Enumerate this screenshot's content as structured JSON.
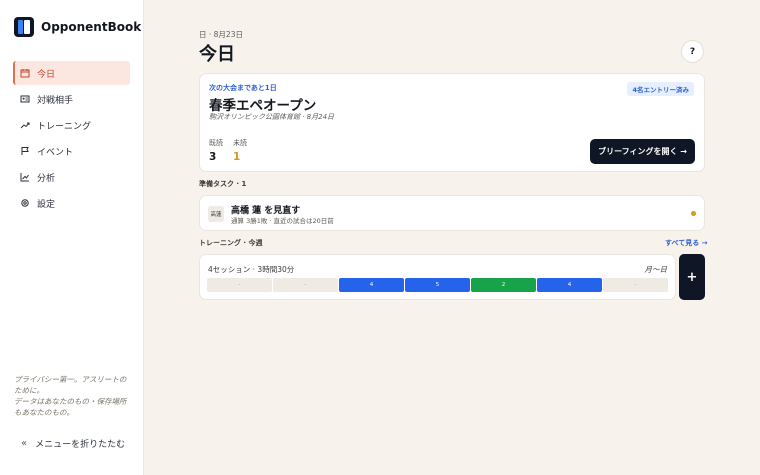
{
  "app": {
    "name": "OpponentBook"
  },
  "nav": {
    "items": [
      {
        "label": "今日",
        "icon": "calendar-icon"
      },
      {
        "label": "対戦相手",
        "icon": "id-card-icon"
      },
      {
        "label": "トレーニング",
        "icon": "trend-icon"
      },
      {
        "label": "イベント",
        "icon": "flag-icon"
      },
      {
        "label": "分析",
        "icon": "chart-icon"
      },
      {
        "label": "設定",
        "icon": "gear-icon"
      }
    ],
    "active_index": 0
  },
  "sidebar_footer": {
    "privacy_line1": "プライバシー第一。アスリートのために。",
    "privacy_line2": "データはあなたのもの・保存場所もあなたのもの。",
    "collapse_label": "メニューを折りたたむ"
  },
  "header": {
    "date": "日 · 8月23日",
    "title": "今日",
    "help_label": "?"
  },
  "event_card": {
    "countdown": "次の大会まであと1日",
    "entry_badge": "4名エントリー済み",
    "name": "春季エペオープン",
    "venue": "駒沢オリンピック公園体育館 · 8月24日",
    "read_label": "既読",
    "read_value": "3",
    "unread_label": "未読",
    "unread_value": "1",
    "briefing_button": "ブリーフィングを開く →"
  },
  "prep": {
    "section_label": "準備タスク · 1",
    "task": {
      "initials": "高蓮",
      "title": "高橋 蓮 を見直す",
      "subtitle": "通算 3勝1敗 · 直近の試合は20日前"
    }
  },
  "training": {
    "section_label": "トレーニング · 今週",
    "see_all": "すべて見る →",
    "summary": "4セッション · 3時間30分",
    "range": "月〜日",
    "days": [
      {
        "label": "-",
        "kind": "empty"
      },
      {
        "label": "-",
        "kind": "empty"
      },
      {
        "label": "4",
        "kind": "blue"
      },
      {
        "label": "5",
        "kind": "blue"
      },
      {
        "label": "2",
        "kind": "green"
      },
      {
        "label": "4",
        "kind": "blue"
      },
      {
        "label": "-",
        "kind": "empty"
      }
    ],
    "add_label": "+"
  },
  "colors": {
    "accent_active": "#e0704f",
    "primary_dark": "#0f1626",
    "link_blue": "#2f5fd0",
    "unread_gold": "#d19a16",
    "session_blue": "#2563eb",
    "session_green": "#16a34a"
  }
}
